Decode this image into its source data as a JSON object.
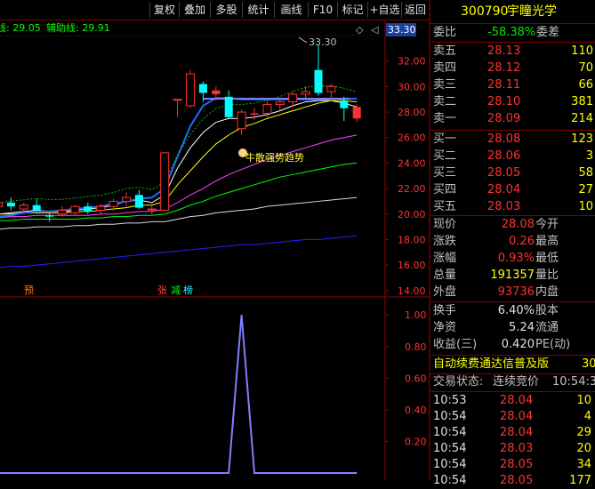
{
  "toolbar": {
    "buttons": [
      "复权",
      "叠加",
      "多股",
      "统计",
      "画线",
      "F10",
      "标记",
      "+自选",
      "返回"
    ]
  },
  "main_chart": {
    "indicator_line": "线: 29.05",
    "aux_line": "辅助线: 29.91",
    "price_box": "33.30",
    "high_label": "33.30",
    "annotation": "牛散强势趋势",
    "markers": [
      "预",
      "张",
      "减",
      "榜"
    ],
    "y_ticks": [
      "32.00",
      "30.00",
      "28.00",
      "26.00",
      "24.00",
      "22.00",
      "20.00",
      "18.00",
      "16.00",
      "14.00"
    ],
    "sub_y_ticks": [
      "1.00",
      "0.80",
      "0.60",
      "0.40",
      "0.20"
    ]
  },
  "chart_data": [
    {
      "type": "candlestick",
      "title": "",
      "ylim": [
        13.5,
        34
      ],
      "y_ticks": [
        14,
        16,
        18,
        20,
        22,
        24,
        26,
        28,
        30,
        32
      ],
      "candles": [
        {
          "o": 20.6,
          "h": 21.2,
          "l": 20.2,
          "c": 20.9,
          "color": "red"
        },
        {
          "o": 20.6,
          "h": 21.3,
          "l": 20.3,
          "c": 20.9,
          "color": "cyan"
        },
        {
          "o": 20.4,
          "h": 20.9,
          "l": 20.0,
          "c": 20.7,
          "color": "red"
        },
        {
          "o": 20.7,
          "h": 21.2,
          "l": 20.4,
          "c": 20.3,
          "color": "cyan"
        },
        {
          "o": 19.8,
          "h": 20.1,
          "l": 19.4,
          "c": 19.9,
          "color": "cyan"
        },
        {
          "o": 20.0,
          "h": 20.6,
          "l": 19.8,
          "c": 20.3,
          "color": "red"
        },
        {
          "o": 20.1,
          "h": 20.7,
          "l": 19.9,
          "c": 20.6,
          "color": "red"
        },
        {
          "o": 20.6,
          "h": 20.9,
          "l": 20.0,
          "c": 20.2,
          "color": "cyan"
        },
        {
          "o": 20.3,
          "h": 20.8,
          "l": 20.0,
          "c": 20.6,
          "color": "red"
        },
        {
          "o": 20.6,
          "h": 21.2,
          "l": 20.3,
          "c": 21.0,
          "color": "red"
        },
        {
          "o": 21.0,
          "h": 21.7,
          "l": 20.6,
          "c": 21.3,
          "color": "red"
        },
        {
          "o": 21.5,
          "h": 21.9,
          "l": 20.4,
          "c": 20.5,
          "color": "cyan"
        },
        {
          "o": 20.4,
          "h": 20.8,
          "l": 20.0,
          "c": 20.4,
          "color": "red"
        },
        {
          "o": 20.3,
          "h": 24.9,
          "l": 20.3,
          "c": 24.8,
          "color": "red"
        },
        {
          "o": 29.0,
          "h": 29.0,
          "l": 27.6,
          "c": 29.0,
          "color": "red"
        },
        {
          "o": 28.5,
          "h": 31.3,
          "l": 28.3,
          "c": 31.0,
          "color": "red"
        },
        {
          "o": 30.2,
          "h": 30.4,
          "l": 28.8,
          "c": 29.5,
          "color": "cyan"
        },
        {
          "o": 29.7,
          "h": 30.0,
          "l": 28.9,
          "c": 29.4,
          "color": "red"
        },
        {
          "o": 29.2,
          "h": 29.7,
          "l": 27.5,
          "c": 27.6,
          "color": "cyan"
        },
        {
          "o": 26.7,
          "h": 28.2,
          "l": 26.2,
          "c": 28.0,
          "color": "red"
        },
        {
          "o": 27.9,
          "h": 28.3,
          "l": 27.4,
          "c": 27.8,
          "color": "red"
        },
        {
          "o": 27.9,
          "h": 28.9,
          "l": 27.6,
          "c": 28.6,
          "color": "red"
        },
        {
          "o": 28.6,
          "h": 29.0,
          "l": 28.1,
          "c": 28.8,
          "color": "red"
        },
        {
          "o": 28.8,
          "h": 29.6,
          "l": 28.4,
          "c": 29.4,
          "color": "red"
        },
        {
          "o": 29.4,
          "h": 30.0,
          "l": 28.9,
          "c": 29.6,
          "color": "red"
        },
        {
          "o": 31.3,
          "h": 33.3,
          "l": 29.3,
          "c": 29.5,
          "color": "cyan"
        },
        {
          "o": 29.6,
          "h": 30.2,
          "l": 28.9,
          "c": 30.0,
          "color": "red"
        },
        {
          "o": 28.9,
          "h": 29.2,
          "l": 27.3,
          "c": 28.3,
          "color": "cyan"
        },
        {
          "o": 28.4,
          "h": 28.6,
          "l": 27.2,
          "c": 27.5,
          "color": "red"
        }
      ],
      "series": [
        {
          "name": "",
          "color": "#ffffff",
          "values": [
            20.0,
            20.1,
            20.2,
            20.3,
            20.2,
            20.2,
            20.3,
            20.4,
            20.5,
            20.7,
            21.0,
            21.1,
            20.9,
            21.5,
            23.6,
            25.2,
            26.4,
            27.2,
            27.5,
            27.5,
            27.6,
            27.8,
            28.1,
            28.5,
            28.8,
            28.9,
            28.9,
            28.7,
            28.4
          ]
        },
        {
          "name": "",
          "color": "#ffff00",
          "values": [
            20.0,
            20.0,
            20.1,
            20.1,
            20.1,
            20.1,
            20.2,
            20.2,
            20.3,
            20.4,
            20.5,
            20.7,
            20.7,
            21.0,
            22.3,
            23.4,
            24.5,
            25.5,
            26.2,
            26.8,
            27.1,
            27.5,
            27.8,
            28.1,
            28.4,
            28.7,
            28.9,
            28.9,
            28.8
          ]
        },
        {
          "name": "",
          "color": "#ff40ff",
          "values": [
            19.7,
            19.8,
            19.8,
            19.9,
            19.9,
            19.9,
            19.9,
            19.9,
            20.0,
            20.0,
            20.1,
            20.2,
            20.2,
            20.4,
            20.9,
            21.5,
            22.0,
            22.6,
            23.1,
            23.5,
            23.9,
            24.3,
            24.6,
            24.9,
            25.2,
            25.5,
            25.8,
            26.0,
            26.2
          ]
        },
        {
          "name": "",
          "color": "#00ff00",
          "values": [
            19.5,
            19.5,
            19.6,
            19.6,
            19.6,
            19.6,
            19.6,
            19.7,
            19.7,
            19.8,
            19.8,
            19.9,
            19.9,
            20.0,
            20.3,
            20.7,
            21.0,
            21.4,
            21.7,
            22.0,
            22.3,
            22.6,
            22.9,
            23.1,
            23.3,
            23.5,
            23.7,
            23.9,
            24.0
          ]
        },
        {
          "name": "",
          "color": "#dcdcdc",
          "values": [
            18.8,
            18.9,
            18.9,
            19.0,
            19.0,
            19.0,
            19.1,
            19.1,
            19.2,
            19.2,
            19.3,
            19.3,
            19.4,
            19.4,
            19.6,
            19.8,
            19.9,
            20.1,
            20.2,
            20.3,
            20.4,
            20.6,
            20.7,
            20.8,
            20.9,
            21.0,
            21.1,
            21.2,
            21.3
          ]
        },
        {
          "name": "",
          "color": "#2020ff",
          "values": [
            15.8,
            15.9,
            15.9,
            16.0,
            16.1,
            16.2,
            16.3,
            16.4,
            16.5,
            16.6,
            16.7,
            16.8,
            16.9,
            17.0,
            17.1,
            17.2,
            17.3,
            17.4,
            17.5,
            17.6,
            17.6,
            17.7,
            17.8,
            17.9,
            18.0,
            18.0,
            18.1,
            18.2,
            18.3
          ]
        },
        {
          "name": "",
          "color": "#1e6cff",
          "values": [
            19.8,
            19.9,
            20.1,
            20.2,
            20.2,
            20.3,
            20.4,
            20.5,
            20.6,
            20.8,
            21.0,
            21.2,
            21.3,
            22.0,
            24.5,
            26.9,
            28.5,
            29.1,
            29.1,
            29.0,
            29.0,
            29.0,
            29.0,
            29.0,
            29.0,
            29.0,
            29.05,
            29.05,
            29.05
          ]
        }
      ]
    },
    {
      "type": "line",
      "title": "",
      "ylim": [
        0,
        1.08
      ],
      "y_ticks": [
        0.2,
        0.4,
        0.6,
        0.8,
        1.0
      ],
      "series": [
        {
          "name": "",
          "color": "#8080ff",
          "values": [
            0,
            0,
            0,
            0,
            0,
            0,
            0,
            0,
            0,
            0,
            0,
            0,
            0,
            0,
            0,
            0,
            0,
            0,
            0,
            1,
            0,
            0,
            0,
            0,
            0,
            0,
            0,
            0,
            0
          ]
        }
      ]
    }
  ],
  "quote": {
    "code": "300790",
    "name": "宇瞳光学",
    "weibi_label": "委比",
    "weibi_value": "-58.38%",
    "weicha_label": "委差",
    "asks": [
      {
        "label": "卖五",
        "price": "28.13",
        "vol": "110"
      },
      {
        "label": "卖四",
        "price": "28.12",
        "vol": "70"
      },
      {
        "label": "卖三",
        "price": "28.11",
        "vol": "66"
      },
      {
        "label": "卖二",
        "price": "28.10",
        "vol": "381"
      },
      {
        "label": "卖一",
        "price": "28.09",
        "vol": "214"
      }
    ],
    "bids": [
      {
        "label": "买一",
        "price": "28.08",
        "vol": "123"
      },
      {
        "label": "买二",
        "price": "28.06",
        "vol": "3"
      },
      {
        "label": "买三",
        "price": "28.05",
        "vol": "58"
      },
      {
        "label": "买四",
        "price": "28.04",
        "vol": "27"
      },
      {
        "label": "买五",
        "price": "28.03",
        "vol": "10"
      }
    ],
    "stats": [
      {
        "l1": "现价",
        "v1": "28.08",
        "l2": "今开",
        "color": "red"
      },
      {
        "l1": "涨跌",
        "v1": "0.26",
        "l2": "最高",
        "color": "red"
      },
      {
        "l1": "涨幅",
        "v1": "0.93%",
        "l2": "最低",
        "color": "red"
      },
      {
        "l1": "总量",
        "v1": "191357",
        "l2": "量比",
        "color": "yellow"
      },
      {
        "l1": "外盘",
        "v1": "93736",
        "l2": "内盘",
        "color": "red"
      }
    ],
    "stats2": [
      {
        "l1": "换手",
        "v1": "6.40%",
        "l2": "股本"
      },
      {
        "l1": "净资",
        "v1": "5.24",
        "l2": "流通"
      },
      {
        "l1": "收益(三)",
        "v1": "0.420",
        "l2": "PE(动)"
      }
    ],
    "ad_text": "自动续费通达信普及版",
    "ad_num": "30",
    "status_label": "交易状态:",
    "status_value": "连续竞价",
    "status_time": "10:54:3",
    "trades": [
      {
        "t": "10:53",
        "p": "28.04",
        "v": "10"
      },
      {
        "t": "10:54",
        "p": "28.04",
        "v": "4"
      },
      {
        "t": "10:54",
        "p": "28.04",
        "v": "29"
      },
      {
        "t": "10:54",
        "p": "28.03",
        "v": "20"
      },
      {
        "t": "10:54",
        "p": "28.05",
        "v": "34"
      },
      {
        "t": "10:54",
        "p": "28.05",
        "v": "177"
      }
    ]
  }
}
